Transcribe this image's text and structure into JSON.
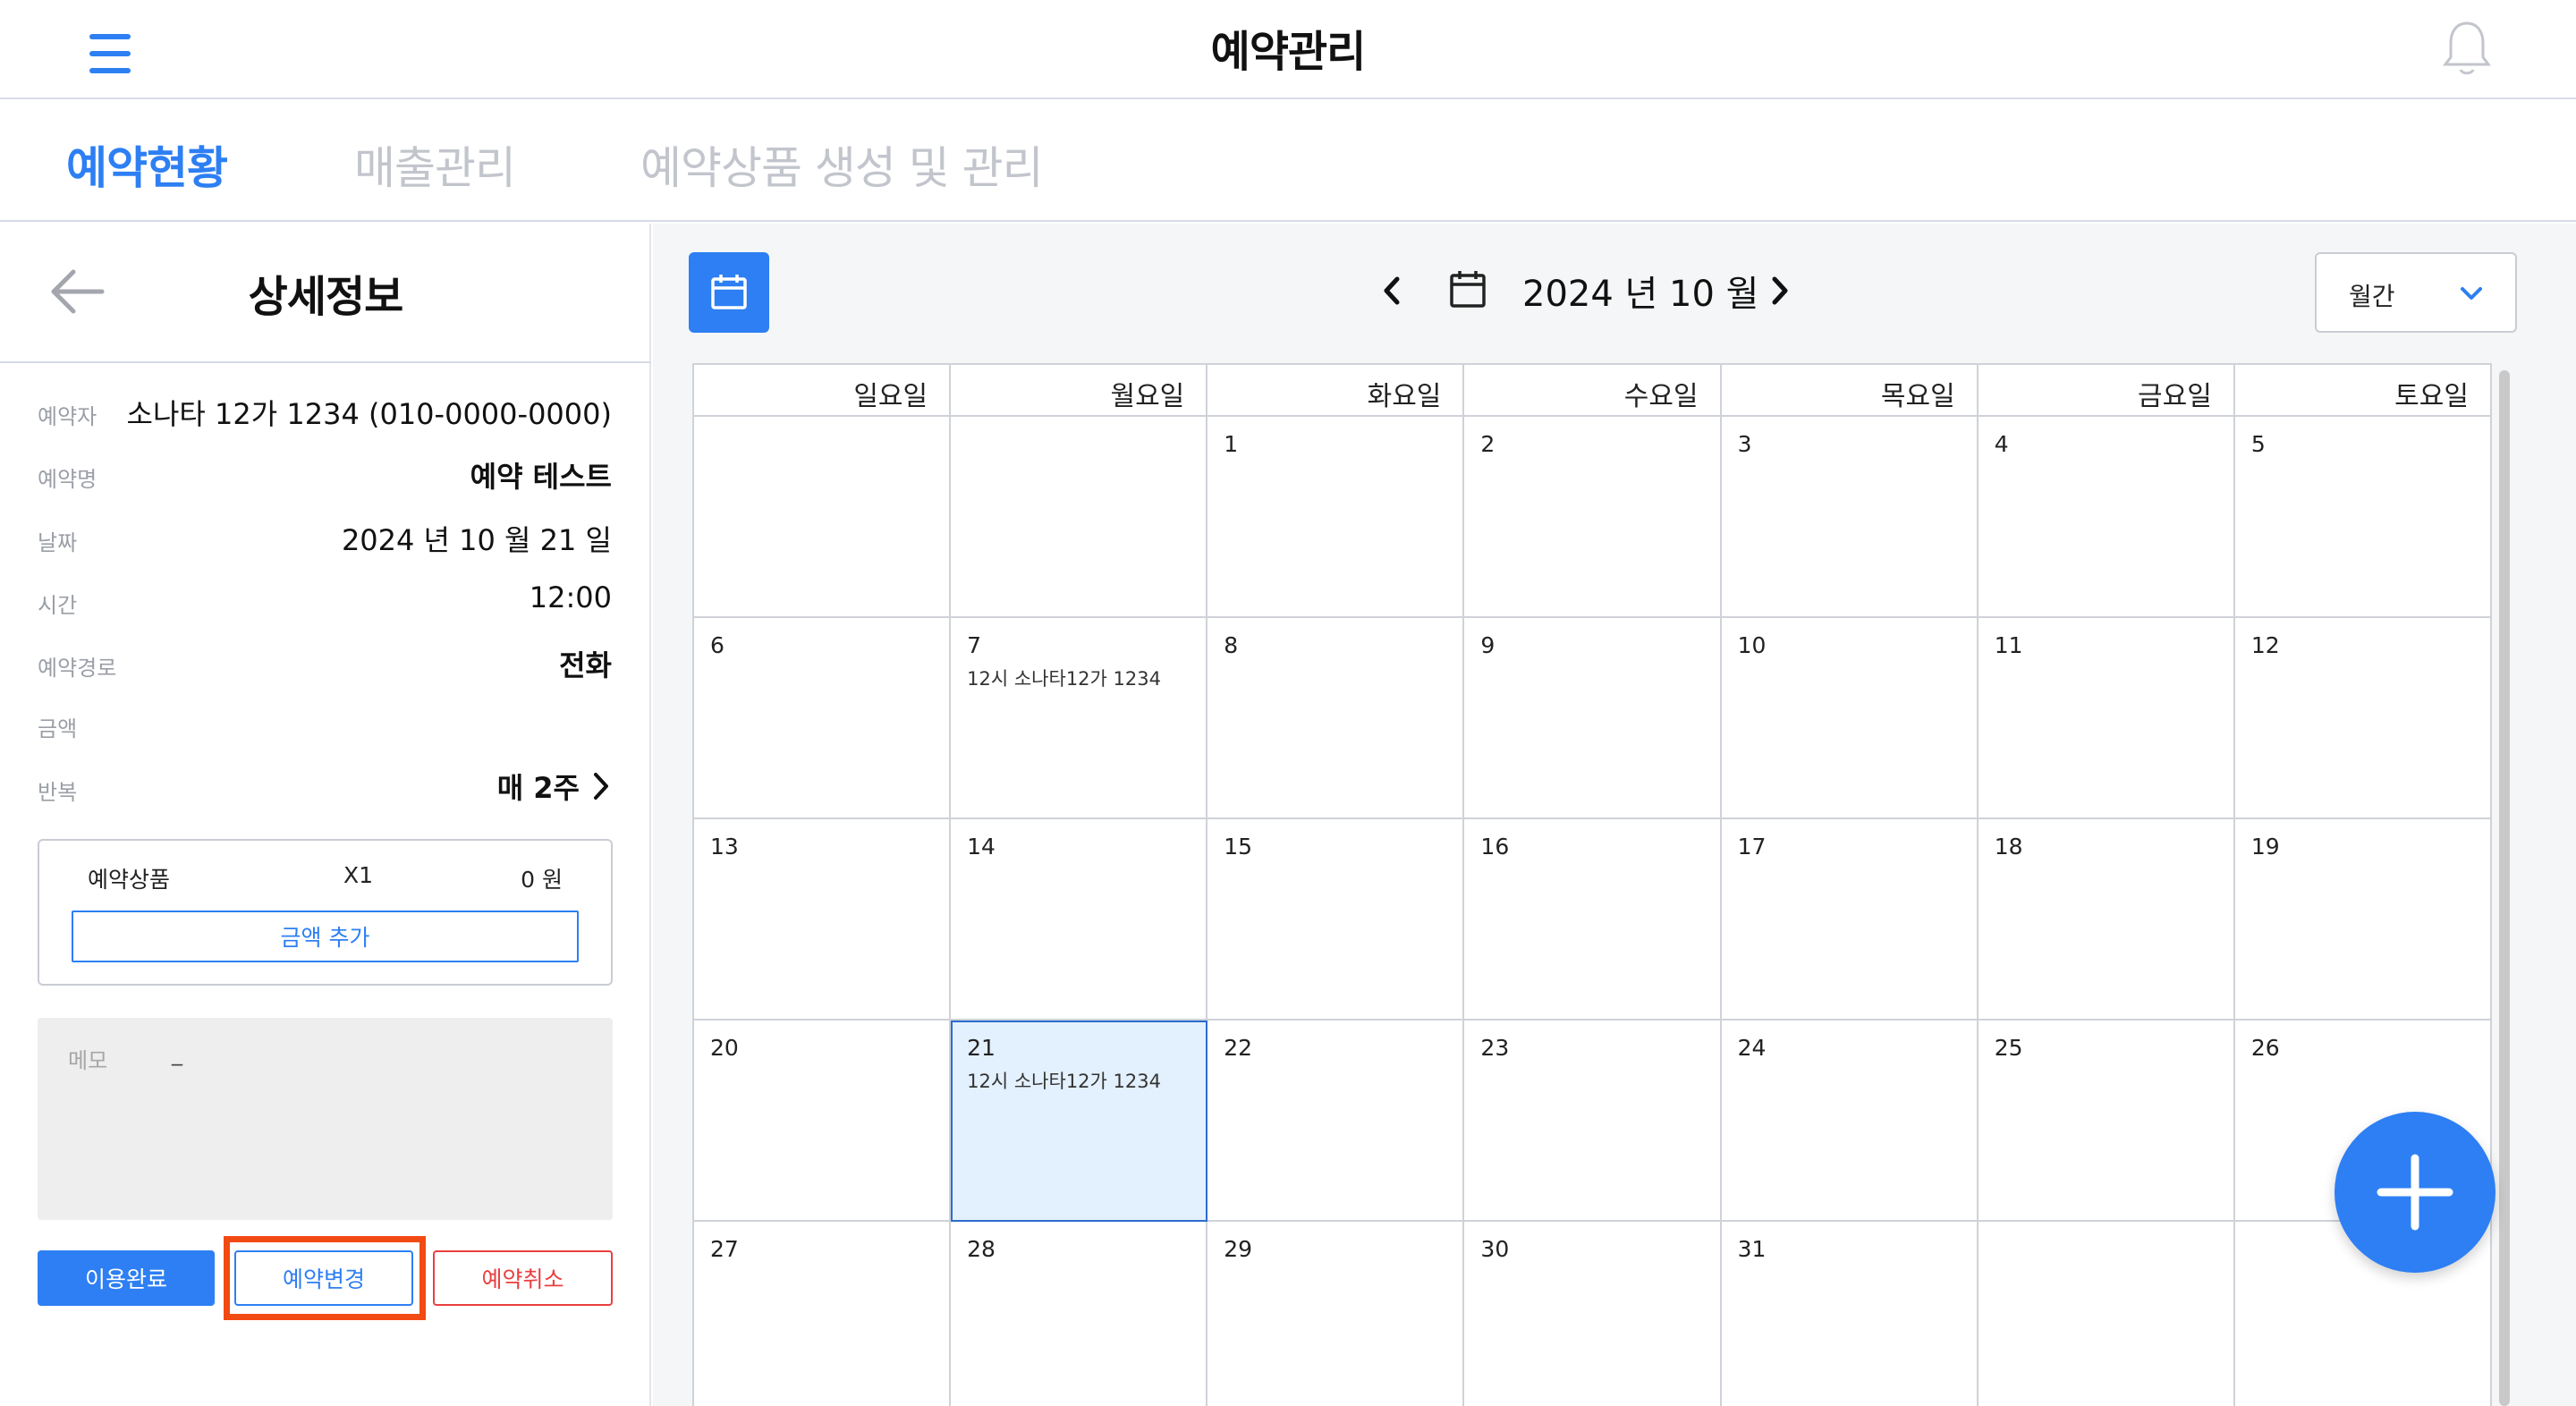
{
  "header": {
    "title": "예약관리",
    "menu_icon": "hamburger-menu-icon",
    "bell_icon": "bell-icon"
  },
  "tabs": [
    {
      "label": "예약현황",
      "active": true
    },
    {
      "label": "매출관리",
      "active": false
    },
    {
      "label": "예약상품 생성 및 관리",
      "active": false
    }
  ],
  "detail": {
    "title": "상세정보",
    "back_icon": "back-arrow-icon",
    "rows": [
      {
        "label": "예약자",
        "value": "소나타 12가 1234 (010-0000-0000)"
      },
      {
        "label": "예약명",
        "value": "예약 테스트"
      },
      {
        "label": "날짜",
        "value": "2024 년 10 월 21 일"
      },
      {
        "label": "시간",
        "value": "12:00"
      },
      {
        "label": "예약경로",
        "value": "전화"
      },
      {
        "label": "금액",
        "value": ""
      },
      {
        "label": "반복",
        "value": "매 2주"
      }
    ],
    "product": {
      "name": "예약상품",
      "qty": "X1",
      "price": "0 원",
      "add_button": "금액 추가"
    },
    "memo": {
      "label": "메모",
      "value": "_"
    },
    "buttons": {
      "complete": "이용완료",
      "change": "예약변경",
      "cancel": "예약취소"
    }
  },
  "calendar": {
    "title": "2024 년  10 월",
    "view_mode": "월간",
    "weekdays": [
      "일요일",
      "월요일",
      "화요일",
      "수요일",
      "목요일",
      "금요일",
      "토요일"
    ],
    "weeks": [
      [
        {
          "day": "",
          "event": ""
        },
        {
          "day": "",
          "event": ""
        },
        {
          "day": "1",
          "event": ""
        },
        {
          "day": "2",
          "event": ""
        },
        {
          "day": "3",
          "event": ""
        },
        {
          "day": "4",
          "event": ""
        },
        {
          "day": "5",
          "event": ""
        }
      ],
      [
        {
          "day": "6",
          "event": ""
        },
        {
          "day": "7",
          "event": "12시 소나타12가 1234"
        },
        {
          "day": "8",
          "event": ""
        },
        {
          "day": "9",
          "event": ""
        },
        {
          "day": "10",
          "event": ""
        },
        {
          "day": "11",
          "event": ""
        },
        {
          "day": "12",
          "event": ""
        }
      ],
      [
        {
          "day": "13",
          "event": ""
        },
        {
          "day": "14",
          "event": ""
        },
        {
          "day": "15",
          "event": ""
        },
        {
          "day": "16",
          "event": ""
        },
        {
          "day": "17",
          "event": ""
        },
        {
          "day": "18",
          "event": ""
        },
        {
          "day": "19",
          "event": ""
        }
      ],
      [
        {
          "day": "20",
          "event": ""
        },
        {
          "day": "21",
          "event": "12시 소나타12가 1234",
          "selected": true
        },
        {
          "day": "22",
          "event": ""
        },
        {
          "day": "23",
          "event": ""
        },
        {
          "day": "24",
          "event": ""
        },
        {
          "day": "25",
          "event": ""
        },
        {
          "day": "26",
          "event": ""
        }
      ],
      [
        {
          "day": "27",
          "event": ""
        },
        {
          "day": "28",
          "event": ""
        },
        {
          "day": "29",
          "event": ""
        },
        {
          "day": "30",
          "event": ""
        },
        {
          "day": "31",
          "event": ""
        },
        {
          "day": "",
          "event": ""
        },
        {
          "day": "",
          "event": ""
        }
      ]
    ],
    "fab_icon": "plus-icon",
    "colors": {
      "accent": "#2d7ff3",
      "selected_bg": "#e3f0fd",
      "cancel": "#ea3f3f",
      "highlight": "#f24a13"
    }
  }
}
